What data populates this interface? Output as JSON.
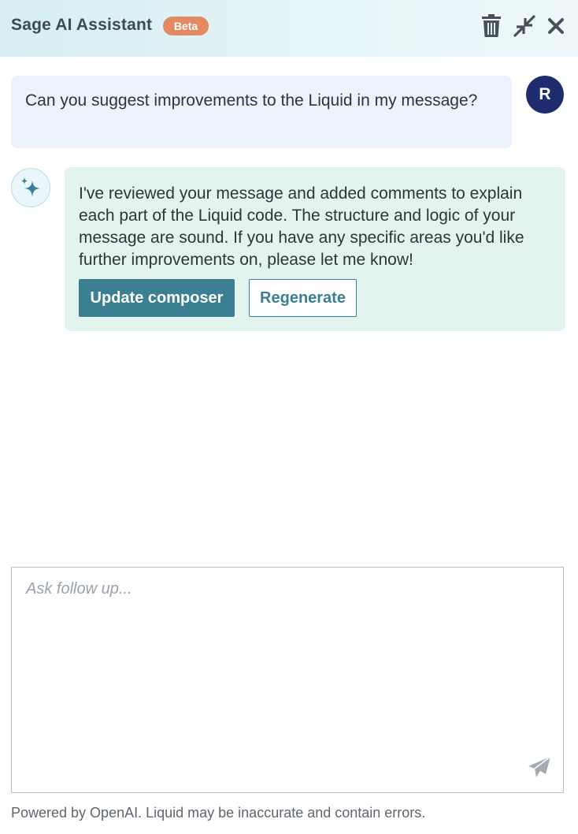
{
  "header": {
    "title": "Sage AI Assistant",
    "badge": "Beta",
    "icons": [
      "trash-icon",
      "minimize-icon",
      "close-icon"
    ]
  },
  "conversation": {
    "user_message": {
      "avatar_initial": "R",
      "text": "Can you suggest improvements to the Liquid in my message?"
    },
    "assistant_message": {
      "avatar_icon": "sparkle-icon",
      "text": "I've reviewed your message and added comments to explain each part of the Liquid code. The structure and logic of your message are sound. If you have any specific areas you'd like further improvements on, please let me know!",
      "primary_action": "Update composer",
      "secondary_action": "Regenerate"
    }
  },
  "composer": {
    "placeholder": "Ask follow up...",
    "value": "",
    "send_icon": "send-icon"
  },
  "footer": {
    "disclaimer": "Powered by OpenAI. Liquid may be inaccurate and contain errors."
  },
  "colors": {
    "accent": "#3a7f92",
    "badge": "#e38a62",
    "user_bubble": "#ecf3fc",
    "assistant_bubble": "#e3f4ee",
    "avatar": "#1f2c6e"
  }
}
